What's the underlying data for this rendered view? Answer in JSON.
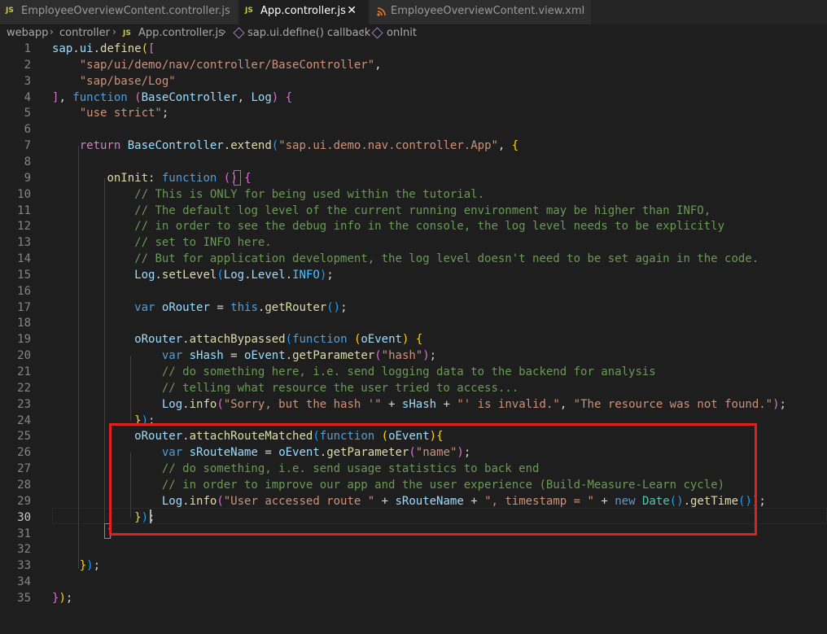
{
  "tabs": [
    {
      "icon": "JS",
      "label": "EmployeeOverviewContent.controller.js",
      "active": false
    },
    {
      "icon": "JS",
      "label": "App.controller.js",
      "active": true,
      "close": "✕"
    },
    {
      "icon": "rss-icon",
      "label": "EmployeeOverviewContent.view.xml",
      "active": false
    }
  ],
  "breadcrumb": {
    "folder1": "webapp",
    "folder2": "controller",
    "file_icon": "JS",
    "file": "App.controller.js",
    "symbol1": "sap.ui.define() callback",
    "symbol2": "onInit"
  },
  "editor": {
    "line_numbers": [
      "1",
      "2",
      "3",
      "4",
      "5",
      "6",
      "7",
      "8",
      "9",
      "10",
      "11",
      "12",
      "13",
      "14",
      "15",
      "16",
      "17",
      "18",
      "19",
      "20",
      "21",
      "22",
      "23",
      "24",
      "25",
      "26",
      "27",
      "28",
      "29",
      "30",
      "31",
      "32",
      "33",
      "34",
      "35"
    ],
    "current_line": 30,
    "code_lines": [
      "sap.ui.define([",
      "    \"sap/ui/demo/nav/controller/BaseController\",",
      "    \"sap/base/Log\"",
      "], function (BaseController, Log) {",
      "    \"use strict\";",
      "",
      "    return BaseController.extend(\"sap.ui.demo.nav.controller.App\", {",
      "",
      "        onInit: function () {",
      "            // This is ONLY for being used within the tutorial.",
      "            // The default log level of the current running environment may be higher than INFO,",
      "            // in order to see the debug info in the console, the log level needs to be explicitly",
      "            // set to INFO here.",
      "            // But for application development, the log level doesn't need to be set again in the code.",
      "            Log.setLevel(Log.Level.INFO);",
      "",
      "            var oRouter = this.getRouter();",
      "",
      "            oRouter.attachBypassed(function (oEvent) {",
      "                var sHash = oEvent.getParameter(\"hash\");",
      "                // do something here, i.e. send logging data to the backend for analysis",
      "                // telling what resource the user tried to access...",
      "                Log.info(\"Sorry, but the hash '\" + sHash + \"' is invalid.\", \"The resource was not found.\");",
      "            });",
      "            oRouter.attachRouteMatched(function (oEvent){",
      "                var sRouteName = oEvent.getParameter(\"name\");",
      "                // do something, i.e. send usage statistics to back end",
      "                // in order to improve our app and the user experience (Build-Measure-Learn cycle)",
      "                Log.info(\"User accessed route \" + sRouteName + \", timestamp = \" + new Date().getTime());",
      "            });",
      "        }",
      "",
      "    });",
      "",
      "});"
    ]
  },
  "colors": {
    "keyword": "#569cd6",
    "string": "#ce9178",
    "comment": "#6a9955",
    "function": "#dcdcaa",
    "variable": "#9cdcfe",
    "highlight_box": "#e02020"
  }
}
